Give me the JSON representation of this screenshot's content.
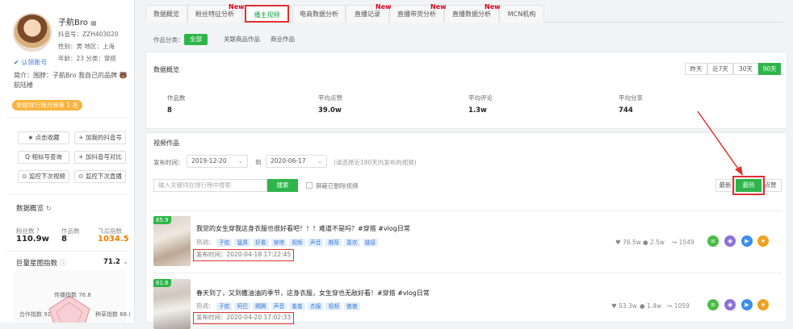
{
  "profile": {
    "name": "子航Bro",
    "douyin_id": "抖音号：ZZH403020",
    "gender_region": "性别：男   地区：上海",
    "age_type": "年龄：23   分类：穿搭",
    "verify": "认领账号",
    "intro": "简介：围脖：子航Bro 我自己的品牌 🐻 航陆楼",
    "rank_badge": "穿搭排行榜月榜第 1 名",
    "buttons": [
      "★ 点击收藏",
      "+ 加我的抖音号",
      "Q 相似号查询",
      "+ 加抖音号对比",
      "⊙ 监控下次视频",
      "⊙ 监控下次直播"
    ]
  },
  "overview": {
    "title": "数据概览",
    "fans_label": "粉丝数 ?",
    "fans": "110.9w",
    "works_label": "作品数",
    "works": "8",
    "index_label": "飞瓜指数",
    "index": "1034.5",
    "star_label": "巨量星图指数",
    "star": "71.2",
    "radar_top": "传播指数 76.8",
    "radar_left": "合作指数 91",
    "radar_right": "种草指数 68.("
  },
  "tabs": [
    {
      "label": "数据概览",
      "new": ""
    },
    {
      "label": "粉丝特征分析",
      "new": "New"
    },
    {
      "label": "播主视频",
      "new": ""
    },
    {
      "label": "电商数据分析",
      "new": ""
    },
    {
      "label": "直播记录",
      "new": "New"
    },
    {
      "label": "直播带货分析",
      "new": "New"
    },
    {
      "label": "直播数据分析",
      "new": "New"
    },
    {
      "label": "MCN机构",
      "new": ""
    }
  ],
  "category": {
    "label": "作品分类：",
    "options": [
      "全部",
      "关联商品作品",
      "商业作品"
    ]
  },
  "data_overview": {
    "title": "数据概览",
    "ranges": [
      "昨天",
      "近7天",
      "30天",
      "90天"
    ],
    "metrics": [
      {
        "label": "作品数",
        "value": "8"
      },
      {
        "label": "平均点赞",
        "value": "39.0w"
      },
      {
        "label": "平均评论",
        "value": "1.3w"
      },
      {
        "label": "平均分享",
        "value": "744"
      }
    ]
  },
  "videos_section": {
    "title": "视频作品",
    "time_label": "发布时间：",
    "start_date": "2019-12-20",
    "to": "到",
    "end_date": "2020-06-17",
    "hint": "(请选择近180天内发布的视频)",
    "search_placeholder": "输入关键词在排行榜中搜索",
    "search_btn": "搜索",
    "hide_deleted": "屏蔽已删除视频",
    "sort": [
      "最新",
      "最热",
      "点赞"
    ]
  },
  "videos": [
    {
      "score": "65.9",
      "title": "我觉的女生穿我这身衣服也很好看吧！！！难道不是吗？#穿搭 #vlog日常",
      "hot_label": "热词：",
      "tags": [
        "子航",
        "猛男",
        "好看",
        "穿搭",
        "视频",
        "声音",
        "推荐",
        "喜欢",
        "链接"
      ],
      "time": "发布时间：2020-04-18 17:22:45",
      "likes": "♥ 76.5w",
      "comments": "● 2.5w",
      "shares": "↪ 1549"
    },
    {
      "score": "61.6",
      "title": "春天到了，又到撒油油的季节，这身衣服，女生穿也无敌好看！#穿搭 #vlog日常",
      "hot_label": "热词：",
      "tags": [
        "子航",
        "阿巴",
        "踢腾",
        "声音",
        "羞羞",
        "衣服",
        "视频",
        "傲傲"
      ],
      "time": "发布时间：2020-04-20 17:02:33",
      "likes": "♥ 53.3w",
      "comments": "● 1.4w",
      "shares": "↪ 1059"
    }
  ],
  "colors": {
    "accent": "#2eb54a",
    "highlight": "#e03030",
    "tag_bg": "#e6f0fb",
    "index": "#e67e00"
  }
}
